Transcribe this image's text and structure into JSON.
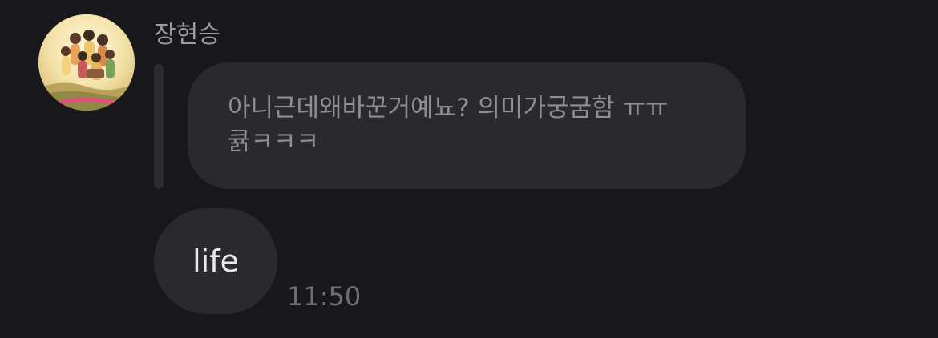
{
  "conversation": {
    "sender_name": "장현승",
    "quoted_message": "아니근데왜바꾼거예뇨? 의미가궁굼함 ㅠㅠ\n큙ㅋㅋㅋ",
    "message_text": "life",
    "timestamp": "11:50"
  },
  "colors": {
    "background": "#18181b",
    "bubble": "#2a2a2e",
    "sender_name": "#9a9a9f",
    "quoted_text": "#8e8e93",
    "message_text": "#e9e9ec",
    "timestamp": "#6e6e73"
  }
}
